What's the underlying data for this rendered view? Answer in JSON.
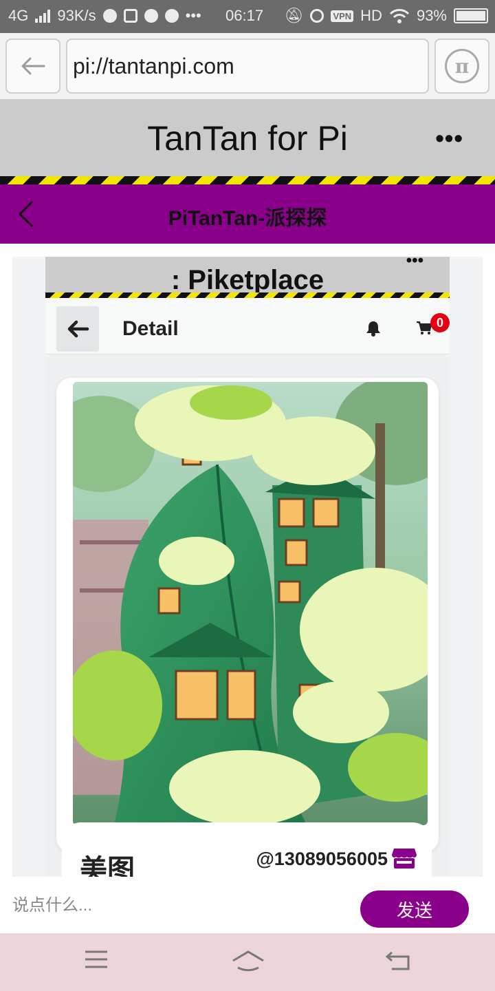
{
  "status_bar": {
    "network": "4G",
    "speed": "93K/s",
    "time": "06:17",
    "hd": "HD",
    "vpn": "VPN",
    "battery": "93%",
    "battery_level": 0.93
  },
  "browser": {
    "url": "pi://tantanpi.com",
    "pi_symbol": "π"
  },
  "app_header": {
    "title": "TanTan for Pi",
    "menu": "•••"
  },
  "nav": {
    "title": "PiTanTan-派探探"
  },
  "embedded_app": {
    "title": ": Piketplace",
    "menu": "•••",
    "detail_title": "Detail",
    "cart_count": "0",
    "item_name": "美图",
    "seller": "@13089056005"
  },
  "comment": {
    "placeholder": "说点什么...",
    "send_label": "发送"
  },
  "colors": {
    "accent": "#8b008b",
    "badge": "#e60012"
  },
  "icons": [
    "back-arrow-icon",
    "pi-icon",
    "chevron-left-icon",
    "bell-icon",
    "cart-icon",
    "store-icon",
    "menu-icon",
    "home-icon",
    "return-icon"
  ]
}
